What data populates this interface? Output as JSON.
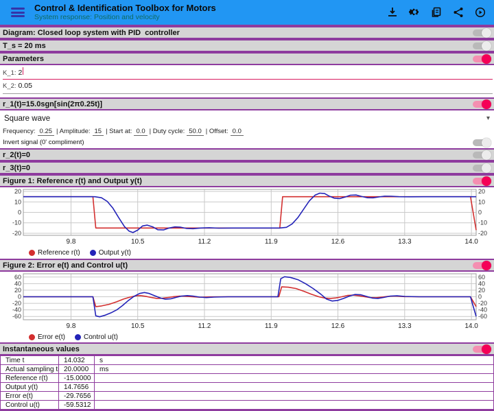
{
  "appbar": {
    "title": "Control & Identification Toolbox for Motors",
    "subtitle": "System response: Position and velocity",
    "icons": [
      "download-icon",
      "settings-gear-icon",
      "copy-pages-icon",
      "share-icon",
      "record-play-icon"
    ]
  },
  "sections": {
    "diagram": {
      "label": "Diagram: Closed loop system with PID  controller",
      "toggle": "off"
    },
    "ts": {
      "label": "T_s = 20 ms",
      "toggle": "off"
    },
    "parameters": {
      "label": "Parameters",
      "toggle": "on"
    },
    "r1": {
      "label": "r_1(t)=15.0sgn[sin(2π0.25t)]",
      "toggle": "on"
    },
    "r2": {
      "label": "r_2(t)=0",
      "toggle": "off"
    },
    "r3": {
      "label": "r_3(t)=0",
      "toggle": "off"
    },
    "figure1": {
      "label": "Figure 1: Reference r(t) and Output y(t)",
      "toggle": "on"
    },
    "figure2": {
      "label": "Figure 2: Error e(t) and Control u(t)",
      "toggle": "on"
    },
    "instant": {
      "label": "Instantaneous values",
      "toggle": "on"
    }
  },
  "parameters": {
    "k1_label": "K_1:",
    "k1_value": "2",
    "k2_label": "K_2:",
    "k2_value": "0.05"
  },
  "signal": {
    "waveform": "Square wave",
    "params": [
      {
        "label": "Frequency:",
        "value": "0.25"
      },
      {
        "label": "| Amplitude:",
        "value": "15"
      },
      {
        "label": "| Start at:",
        "value": "0.0"
      },
      {
        "label": "| Duty cycle:",
        "value": "50.0"
      },
      {
        "label": "| Offset:",
        "value": "0.0"
      }
    ],
    "invert_label": "Invert signal (0' compliment)",
    "invert_toggle": "off"
  },
  "chart_data": [
    {
      "type": "line",
      "title": "Figure 1: Reference r(t) and Output y(t)",
      "xlim": [
        9.3,
        14.05
      ],
      "ylim": [
        -22,
        22
      ],
      "xticks": [
        9.8,
        10.5,
        11.2,
        11.9,
        12.6,
        13.3,
        14.0
      ],
      "yticks": [
        20,
        10,
        0,
        -10,
        -20
      ],
      "grid": true,
      "legend_position": "bottom-left",
      "series": [
        {
          "name": "Reference r(t)",
          "color": "#d32f2f",
          "points": [
            [
              9.3,
              15
            ],
            [
              10.03,
              15
            ],
            [
              10.06,
              -15
            ],
            [
              11.99,
              -15
            ],
            [
              12.02,
              15
            ],
            [
              13.99,
              15
            ],
            [
              14.05,
              -17
            ]
          ]
        },
        {
          "name": "Output y(t)",
          "color": "#2323b8",
          "points": [
            [
              9.3,
              15
            ],
            [
              10.05,
              15
            ],
            [
              10.12,
              14
            ],
            [
              10.18,
              10.5
            ],
            [
              10.24,
              4
            ],
            [
              10.3,
              -5
            ],
            [
              10.36,
              -13.5
            ],
            [
              10.41,
              -18
            ],
            [
              10.45,
              -19.3
            ],
            [
              10.5,
              -17
            ],
            [
              10.55,
              -13
            ],
            [
              10.6,
              -12.2
            ],
            [
              10.66,
              -14
            ],
            [
              10.71,
              -16.6
            ],
            [
              10.77,
              -16.8
            ],
            [
              10.83,
              -15
            ],
            [
              10.89,
              -13.9
            ],
            [
              10.95,
              -14.2
            ],
            [
              11.01,
              -15.4
            ],
            [
              11.08,
              -15.6
            ],
            [
              11.16,
              -15
            ],
            [
              11.25,
              -14.7
            ],
            [
              11.35,
              -15.1
            ],
            [
              11.5,
              -15
            ],
            [
              11.99,
              -15
            ],
            [
              12.06,
              -14.3
            ],
            [
              12.12,
              -11
            ],
            [
              12.18,
              -5
            ],
            [
              12.24,
              3
            ],
            [
              12.3,
              11
            ],
            [
              12.36,
              16.5
            ],
            [
              12.41,
              18.4
            ],
            [
              12.46,
              18
            ],
            [
              12.51,
              15.5
            ],
            [
              12.56,
              13.6
            ],
            [
              12.62,
              13.2
            ],
            [
              12.68,
              14.8
            ],
            [
              12.73,
              16.4
            ],
            [
              12.79,
              16.6
            ],
            [
              12.85,
              15.2
            ],
            [
              12.91,
              14
            ],
            [
              12.97,
              13.9
            ],
            [
              13.03,
              14.8
            ],
            [
              13.09,
              15.5
            ],
            [
              13.16,
              15.4
            ],
            [
              13.24,
              15
            ],
            [
              13.35,
              14.9
            ],
            [
              13.5,
              15
            ],
            [
              14.05,
              15
            ]
          ]
        }
      ]
    },
    {
      "type": "line",
      "title": "Figure 2: Error e(t) and Control u(t)",
      "xlim": [
        9.3,
        14.05
      ],
      "ylim": [
        -70,
        70
      ],
      "xticks": [
        9.8,
        10.5,
        11.2,
        11.9,
        12.6,
        13.3,
        14.0
      ],
      "yticks": [
        60,
        40,
        20,
        0,
        -20,
        -40,
        -60
      ],
      "grid": true,
      "legend_position": "bottom-left",
      "series": [
        {
          "name": "Error e(t)",
          "color": "#d32f2f",
          "points": [
            [
              9.3,
              0
            ],
            [
              10.03,
              0
            ],
            [
              10.06,
              -30
            ],
            [
              10.12,
              -28
            ],
            [
              10.2,
              -23
            ],
            [
              10.28,
              -15
            ],
            [
              10.35,
              -7
            ],
            [
              10.42,
              -1
            ],
            [
              10.48,
              3
            ],
            [
              10.53,
              3.5
            ],
            [
              10.58,
              1.5
            ],
            [
              10.64,
              -2
            ],
            [
              10.7,
              -5
            ],
            [
              10.76,
              -4.5
            ],
            [
              10.82,
              -2
            ],
            [
              10.88,
              0.5
            ],
            [
              10.94,
              2
            ],
            [
              11.0,
              1.5
            ],
            [
              11.07,
              0
            ],
            [
              11.15,
              -1.5
            ],
            [
              11.25,
              -0.5
            ],
            [
              11.4,
              0
            ],
            [
              11.98,
              0
            ],
            [
              12.01,
              30
            ],
            [
              12.08,
              29
            ],
            [
              12.16,
              25
            ],
            [
              12.24,
              17
            ],
            [
              12.32,
              8
            ],
            [
              12.4,
              0
            ],
            [
              12.46,
              -4
            ],
            [
              12.52,
              -5
            ],
            [
              12.58,
              -3.5
            ],
            [
              12.64,
              0
            ],
            [
              12.7,
              4
            ],
            [
              12.76,
              5
            ],
            [
              12.82,
              3
            ],
            [
              12.88,
              0
            ],
            [
              12.94,
              -2.5
            ],
            [
              13.0,
              -3
            ],
            [
              13.06,
              -1
            ],
            [
              13.12,
              1
            ],
            [
              13.2,
              2
            ],
            [
              13.3,
              0.5
            ],
            [
              13.45,
              0
            ],
            [
              13.99,
              0
            ],
            [
              14.02,
              -15
            ],
            [
              14.05,
              -30
            ]
          ]
        },
        {
          "name": "Control u(t)",
          "color": "#2323b8",
          "points": [
            [
              9.3,
              0
            ],
            [
              10.03,
              0
            ],
            [
              10.06,
              -58
            ],
            [
              10.1,
              -61
            ],
            [
              10.16,
              -56
            ],
            [
              10.22,
              -49
            ],
            [
              10.28,
              -40
            ],
            [
              10.34,
              -27
            ],
            [
              10.4,
              -12
            ],
            [
              10.46,
              1
            ],
            [
              10.52,
              10
            ],
            [
              10.57,
              13
            ],
            [
              10.62,
              10
            ],
            [
              10.68,
              3
            ],
            [
              10.74,
              -4
            ],
            [
              10.79,
              -7.5
            ],
            [
              10.85,
              -6
            ],
            [
              10.9,
              -2
            ],
            [
              10.96,
              2
            ],
            [
              11.02,
              3.5
            ],
            [
              11.08,
              2
            ],
            [
              11.15,
              -1
            ],
            [
              11.22,
              -2.5
            ],
            [
              11.3,
              -1
            ],
            [
              11.45,
              0
            ],
            [
              11.97,
              0
            ],
            [
              12.0,
              55
            ],
            [
              12.04,
              61
            ],
            [
              12.1,
              59
            ],
            [
              12.18,
              52
            ],
            [
              12.26,
              40
            ],
            [
              12.34,
              25
            ],
            [
              12.42,
              8
            ],
            [
              12.48,
              -7
            ],
            [
              12.54,
              -13
            ],
            [
              12.6,
              -11
            ],
            [
              12.66,
              -5
            ],
            [
              12.72,
              2
            ],
            [
              12.78,
              7
            ],
            [
              12.84,
              6
            ],
            [
              12.9,
              1
            ],
            [
              12.96,
              -4
            ],
            [
              13.02,
              -5
            ],
            [
              13.08,
              -2
            ],
            [
              13.15,
              2
            ],
            [
              13.22,
              3
            ],
            [
              13.3,
              1
            ],
            [
              13.45,
              0
            ],
            [
              13.99,
              0
            ],
            [
              14.02,
              -30
            ],
            [
              14.05,
              -60
            ]
          ]
        }
      ]
    }
  ],
  "table": {
    "rows": [
      {
        "label": "Time t",
        "value": "14.032",
        "unit": "s"
      },
      {
        "label": "Actual sampling time",
        "value": "20.0000",
        "unit": "ms"
      },
      {
        "label": "Reference r(t)",
        "value": "-15.0000",
        "unit": ""
      },
      {
        "label": "Output y(t)",
        "value": "14.7656",
        "unit": ""
      },
      {
        "label": "Error e(t)",
        "value": "-29.7656",
        "unit": ""
      },
      {
        "label": "Control u(t)",
        "value": "-59.5312",
        "unit": ""
      }
    ]
  },
  "colors": {
    "appbar": "#2196f3",
    "section_border": "#8e3b9e",
    "switch_on": "#f50057",
    "series_red": "#d32f2f",
    "series_blue": "#2323b8"
  }
}
